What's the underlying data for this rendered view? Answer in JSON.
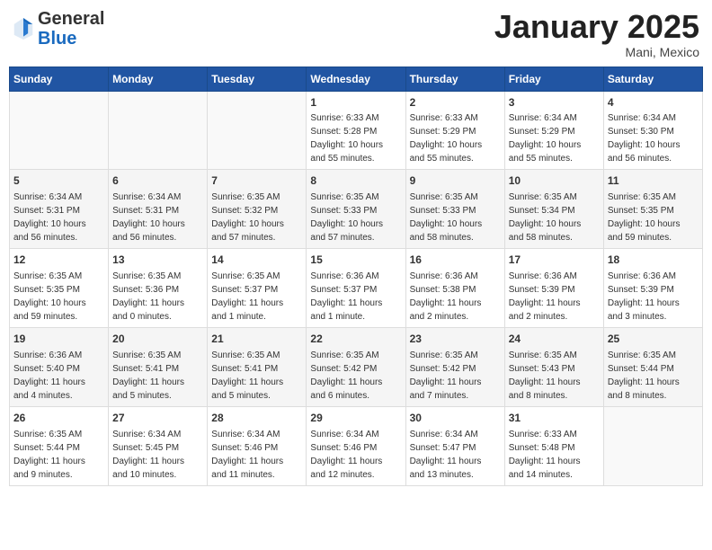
{
  "header": {
    "logo": {
      "text_general": "General",
      "text_blue": "Blue"
    },
    "title": "January 2025",
    "location": "Mani, Mexico"
  },
  "calendar": {
    "days_of_week": [
      "Sunday",
      "Monday",
      "Tuesday",
      "Wednesday",
      "Thursday",
      "Friday",
      "Saturday"
    ],
    "weeks": [
      [
        {
          "day": "",
          "info": ""
        },
        {
          "day": "",
          "info": ""
        },
        {
          "day": "",
          "info": ""
        },
        {
          "day": "1",
          "info": "Sunrise: 6:33 AM\nSunset: 5:28 PM\nDaylight: 10 hours\nand 55 minutes."
        },
        {
          "day": "2",
          "info": "Sunrise: 6:33 AM\nSunset: 5:29 PM\nDaylight: 10 hours\nand 55 minutes."
        },
        {
          "day": "3",
          "info": "Sunrise: 6:34 AM\nSunset: 5:29 PM\nDaylight: 10 hours\nand 55 minutes."
        },
        {
          "day": "4",
          "info": "Sunrise: 6:34 AM\nSunset: 5:30 PM\nDaylight: 10 hours\nand 56 minutes."
        }
      ],
      [
        {
          "day": "5",
          "info": "Sunrise: 6:34 AM\nSunset: 5:31 PM\nDaylight: 10 hours\nand 56 minutes."
        },
        {
          "day": "6",
          "info": "Sunrise: 6:34 AM\nSunset: 5:31 PM\nDaylight: 10 hours\nand 56 minutes."
        },
        {
          "day": "7",
          "info": "Sunrise: 6:35 AM\nSunset: 5:32 PM\nDaylight: 10 hours\nand 57 minutes."
        },
        {
          "day": "8",
          "info": "Sunrise: 6:35 AM\nSunset: 5:33 PM\nDaylight: 10 hours\nand 57 minutes."
        },
        {
          "day": "9",
          "info": "Sunrise: 6:35 AM\nSunset: 5:33 PM\nDaylight: 10 hours\nand 58 minutes."
        },
        {
          "day": "10",
          "info": "Sunrise: 6:35 AM\nSunset: 5:34 PM\nDaylight: 10 hours\nand 58 minutes."
        },
        {
          "day": "11",
          "info": "Sunrise: 6:35 AM\nSunset: 5:35 PM\nDaylight: 10 hours\nand 59 minutes."
        }
      ],
      [
        {
          "day": "12",
          "info": "Sunrise: 6:35 AM\nSunset: 5:35 PM\nDaylight: 10 hours\nand 59 minutes."
        },
        {
          "day": "13",
          "info": "Sunrise: 6:35 AM\nSunset: 5:36 PM\nDaylight: 11 hours\nand 0 minutes."
        },
        {
          "day": "14",
          "info": "Sunrise: 6:35 AM\nSunset: 5:37 PM\nDaylight: 11 hours\nand 1 minute."
        },
        {
          "day": "15",
          "info": "Sunrise: 6:36 AM\nSunset: 5:37 PM\nDaylight: 11 hours\nand 1 minute."
        },
        {
          "day": "16",
          "info": "Sunrise: 6:36 AM\nSunset: 5:38 PM\nDaylight: 11 hours\nand 2 minutes."
        },
        {
          "day": "17",
          "info": "Sunrise: 6:36 AM\nSunset: 5:39 PM\nDaylight: 11 hours\nand 2 minutes."
        },
        {
          "day": "18",
          "info": "Sunrise: 6:36 AM\nSunset: 5:39 PM\nDaylight: 11 hours\nand 3 minutes."
        }
      ],
      [
        {
          "day": "19",
          "info": "Sunrise: 6:36 AM\nSunset: 5:40 PM\nDaylight: 11 hours\nand 4 minutes."
        },
        {
          "day": "20",
          "info": "Sunrise: 6:35 AM\nSunset: 5:41 PM\nDaylight: 11 hours\nand 5 minutes."
        },
        {
          "day": "21",
          "info": "Sunrise: 6:35 AM\nSunset: 5:41 PM\nDaylight: 11 hours\nand 5 minutes."
        },
        {
          "day": "22",
          "info": "Sunrise: 6:35 AM\nSunset: 5:42 PM\nDaylight: 11 hours\nand 6 minutes."
        },
        {
          "day": "23",
          "info": "Sunrise: 6:35 AM\nSunset: 5:42 PM\nDaylight: 11 hours\nand 7 minutes."
        },
        {
          "day": "24",
          "info": "Sunrise: 6:35 AM\nSunset: 5:43 PM\nDaylight: 11 hours\nand 8 minutes."
        },
        {
          "day": "25",
          "info": "Sunrise: 6:35 AM\nSunset: 5:44 PM\nDaylight: 11 hours\nand 8 minutes."
        }
      ],
      [
        {
          "day": "26",
          "info": "Sunrise: 6:35 AM\nSunset: 5:44 PM\nDaylight: 11 hours\nand 9 minutes."
        },
        {
          "day": "27",
          "info": "Sunrise: 6:34 AM\nSunset: 5:45 PM\nDaylight: 11 hours\nand 10 minutes."
        },
        {
          "day": "28",
          "info": "Sunrise: 6:34 AM\nSunset: 5:46 PM\nDaylight: 11 hours\nand 11 minutes."
        },
        {
          "day": "29",
          "info": "Sunrise: 6:34 AM\nSunset: 5:46 PM\nDaylight: 11 hours\nand 12 minutes."
        },
        {
          "day": "30",
          "info": "Sunrise: 6:34 AM\nSunset: 5:47 PM\nDaylight: 11 hours\nand 13 minutes."
        },
        {
          "day": "31",
          "info": "Sunrise: 6:33 AM\nSunset: 5:48 PM\nDaylight: 11 hours\nand 14 minutes."
        },
        {
          "day": "",
          "info": ""
        }
      ]
    ]
  }
}
